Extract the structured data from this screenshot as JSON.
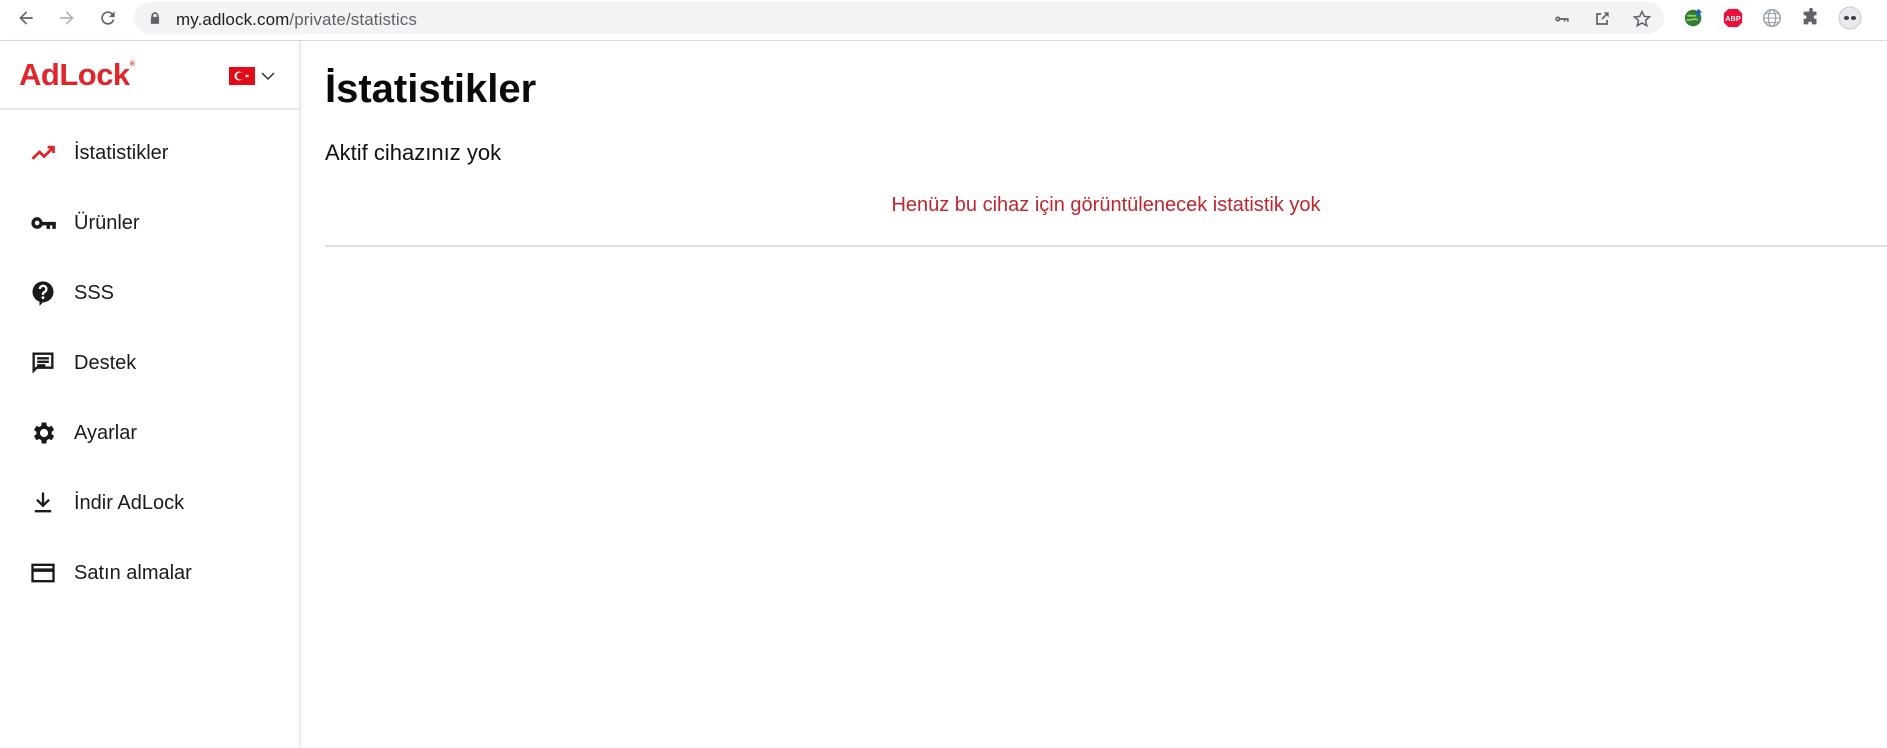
{
  "browser": {
    "url_host": "my.adlock.com",
    "url_path": "/private/statistics",
    "ext_abp_label": "ABP"
  },
  "sidebar": {
    "brand": "AdLock",
    "brand_mark": "®",
    "language": "Türkçe",
    "items": [
      {
        "label": "İstatistikler",
        "icon": "trend-chart-icon",
        "active": true
      },
      {
        "label": "Ürünler",
        "icon": "key-icon",
        "active": false
      },
      {
        "label": "SSS",
        "icon": "help-circle-icon",
        "active": false
      },
      {
        "label": "Destek",
        "icon": "chat-icon",
        "active": false
      },
      {
        "label": "Ayarlar",
        "icon": "gear-icon",
        "active": false
      },
      {
        "label": "İndir AdLock",
        "icon": "download-icon",
        "active": false
      },
      {
        "label": "Satın almalar",
        "icon": "credit-card-icon",
        "active": false
      }
    ]
  },
  "main": {
    "title": "İstatistikler",
    "device_status": "Aktif cihazınız yok",
    "empty_message": "Henüz bu cihaz için görüntülenecek istatistik yok"
  },
  "colors": {
    "brand_red": "#e0262b",
    "message_red": "#c0272d"
  }
}
